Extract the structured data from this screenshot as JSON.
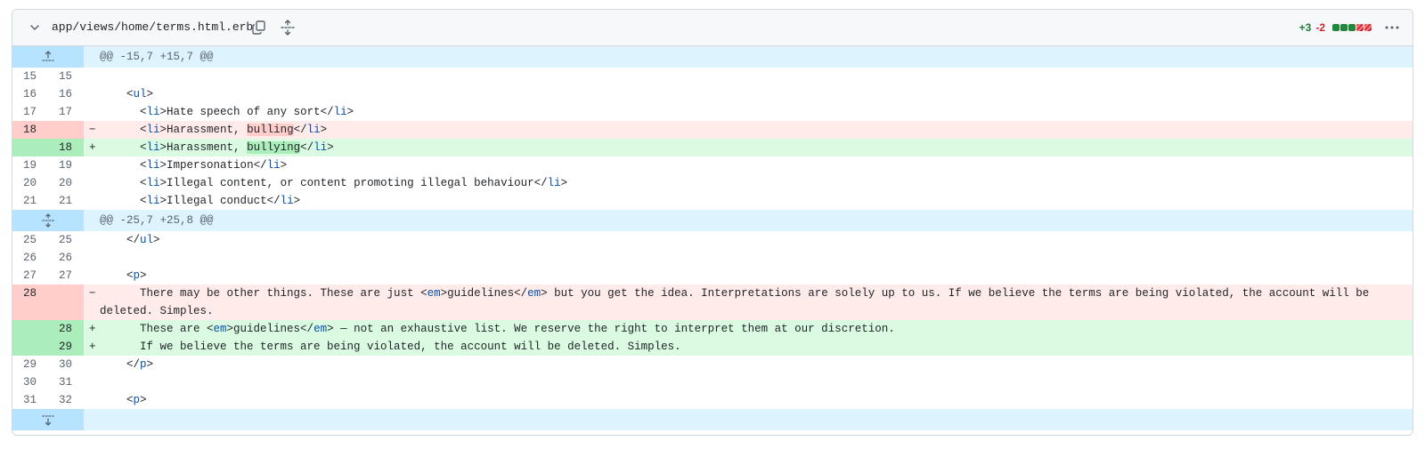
{
  "file": {
    "path": "app/views/home/terms.html.erb",
    "additions": "+3",
    "deletions": "-2",
    "stat_blocks": [
      "added",
      "added",
      "added",
      "deleted",
      "deleted"
    ]
  },
  "hunks": [
    {
      "header": "@@ -15,7 +15,7 @@",
      "icon": "expand-up-icon"
    },
    {
      "header": "@@ -25,7 +25,8 @@",
      "icon": "expand-both-icon"
    },
    {
      "header": "",
      "icon": "expand-down-icon"
    }
  ],
  "lines": [
    {
      "old": "15",
      "new": "15",
      "type": "ctx",
      "segments": []
    },
    {
      "old": "16",
      "new": "16",
      "type": "ctx",
      "segments": [
        {
          "t": "    <"
        },
        {
          "t": "ul",
          "c": "tag"
        },
        {
          "t": ">"
        }
      ]
    },
    {
      "old": "17",
      "new": "17",
      "type": "ctx",
      "segments": [
        {
          "t": "      <"
        },
        {
          "t": "li",
          "c": "tag"
        },
        {
          "t": ">Hate speech of any sort</"
        },
        {
          "t": "li",
          "c": "tag"
        },
        {
          "t": ">"
        }
      ]
    },
    {
      "old": "18",
      "new": "",
      "type": "del",
      "marker": "−",
      "segments": [
        {
          "t": "      <"
        },
        {
          "t": "li",
          "c": "tag"
        },
        {
          "t": ">Harassment, "
        },
        {
          "t": "bulling",
          "c": "hl-del"
        },
        {
          "t": "</"
        },
        {
          "t": "li",
          "c": "tag"
        },
        {
          "t": ">"
        }
      ]
    },
    {
      "old": "",
      "new": "18",
      "type": "add",
      "marker": "+",
      "segments": [
        {
          "t": "      <"
        },
        {
          "t": "li",
          "c": "tag"
        },
        {
          "t": ">Harassment, "
        },
        {
          "t": "bullying",
          "c": "hl-add"
        },
        {
          "t": "</"
        },
        {
          "t": "li",
          "c": "tag"
        },
        {
          "t": ">"
        }
      ]
    },
    {
      "old": "19",
      "new": "19",
      "type": "ctx",
      "segments": [
        {
          "t": "      <"
        },
        {
          "t": "li",
          "c": "tag"
        },
        {
          "t": ">Impersonation</"
        },
        {
          "t": "li",
          "c": "tag"
        },
        {
          "t": ">"
        }
      ]
    },
    {
      "old": "20",
      "new": "20",
      "type": "ctx",
      "segments": [
        {
          "t": "      <"
        },
        {
          "t": "li",
          "c": "tag"
        },
        {
          "t": ">Illegal content, or content promoting illegal behaviour</"
        },
        {
          "t": "li",
          "c": "tag"
        },
        {
          "t": ">"
        }
      ]
    },
    {
      "old": "21",
      "new": "21",
      "type": "ctx",
      "segments": [
        {
          "t": "      <"
        },
        {
          "t": "li",
          "c": "tag"
        },
        {
          "t": ">Illegal conduct</"
        },
        {
          "t": "li",
          "c": "tag"
        },
        {
          "t": ">"
        }
      ]
    },
    {
      "hunk": 1
    },
    {
      "old": "25",
      "new": "25",
      "type": "ctx",
      "segments": [
        {
          "t": "    </"
        },
        {
          "t": "ul",
          "c": "tag"
        },
        {
          "t": ">"
        }
      ]
    },
    {
      "old": "26",
      "new": "26",
      "type": "ctx",
      "segments": []
    },
    {
      "old": "27",
      "new": "27",
      "type": "ctx",
      "segments": [
        {
          "t": "    <"
        },
        {
          "t": "p",
          "c": "tag"
        },
        {
          "t": ">"
        }
      ]
    },
    {
      "old": "28",
      "new": "",
      "type": "del",
      "marker": "−",
      "tall": true,
      "segments": [
        {
          "t": "      There may be other things. These are just <"
        },
        {
          "t": "em",
          "c": "tag"
        },
        {
          "t": ">guidelines</"
        },
        {
          "t": "em",
          "c": "tag"
        },
        {
          "t": "> but you get the idea. Interpretations are solely up to us. If we believe the terms are being violated, the account will be deleted. Simples."
        }
      ]
    },
    {
      "old": "",
      "new": "28",
      "type": "add",
      "marker": "+",
      "segments": [
        {
          "t": "      These are <"
        },
        {
          "t": "em",
          "c": "tag"
        },
        {
          "t": ">guidelines</"
        },
        {
          "t": "em",
          "c": "tag"
        },
        {
          "t": "> — not an exhaustive list. We reserve the right to interpret them at our discretion."
        }
      ]
    },
    {
      "old": "",
      "new": "29",
      "type": "add",
      "marker": "+",
      "segments": [
        {
          "t": "      If we believe the terms are being violated, the account will be deleted. Simples."
        }
      ]
    },
    {
      "old": "29",
      "new": "30",
      "type": "ctx",
      "segments": [
        {
          "t": "    </"
        },
        {
          "t": "p",
          "c": "tag"
        },
        {
          "t": ">"
        }
      ]
    },
    {
      "old": "30",
      "new": "31",
      "type": "ctx",
      "segments": []
    },
    {
      "old": "31",
      "new": "32",
      "type": "ctx",
      "segments": [
        {
          "t": "    <"
        },
        {
          "t": "p",
          "c": "tag"
        },
        {
          "t": ">"
        }
      ]
    },
    {
      "hunk": 2
    }
  ],
  "colors": {
    "add_bg": "#dafbe1",
    "add_gutter": "#aceebb",
    "del_bg": "#ffebe9",
    "del_gutter": "#ffcecb",
    "hunk_bg": "#ddf4ff",
    "hunk_gutter": "#b6e3ff"
  }
}
